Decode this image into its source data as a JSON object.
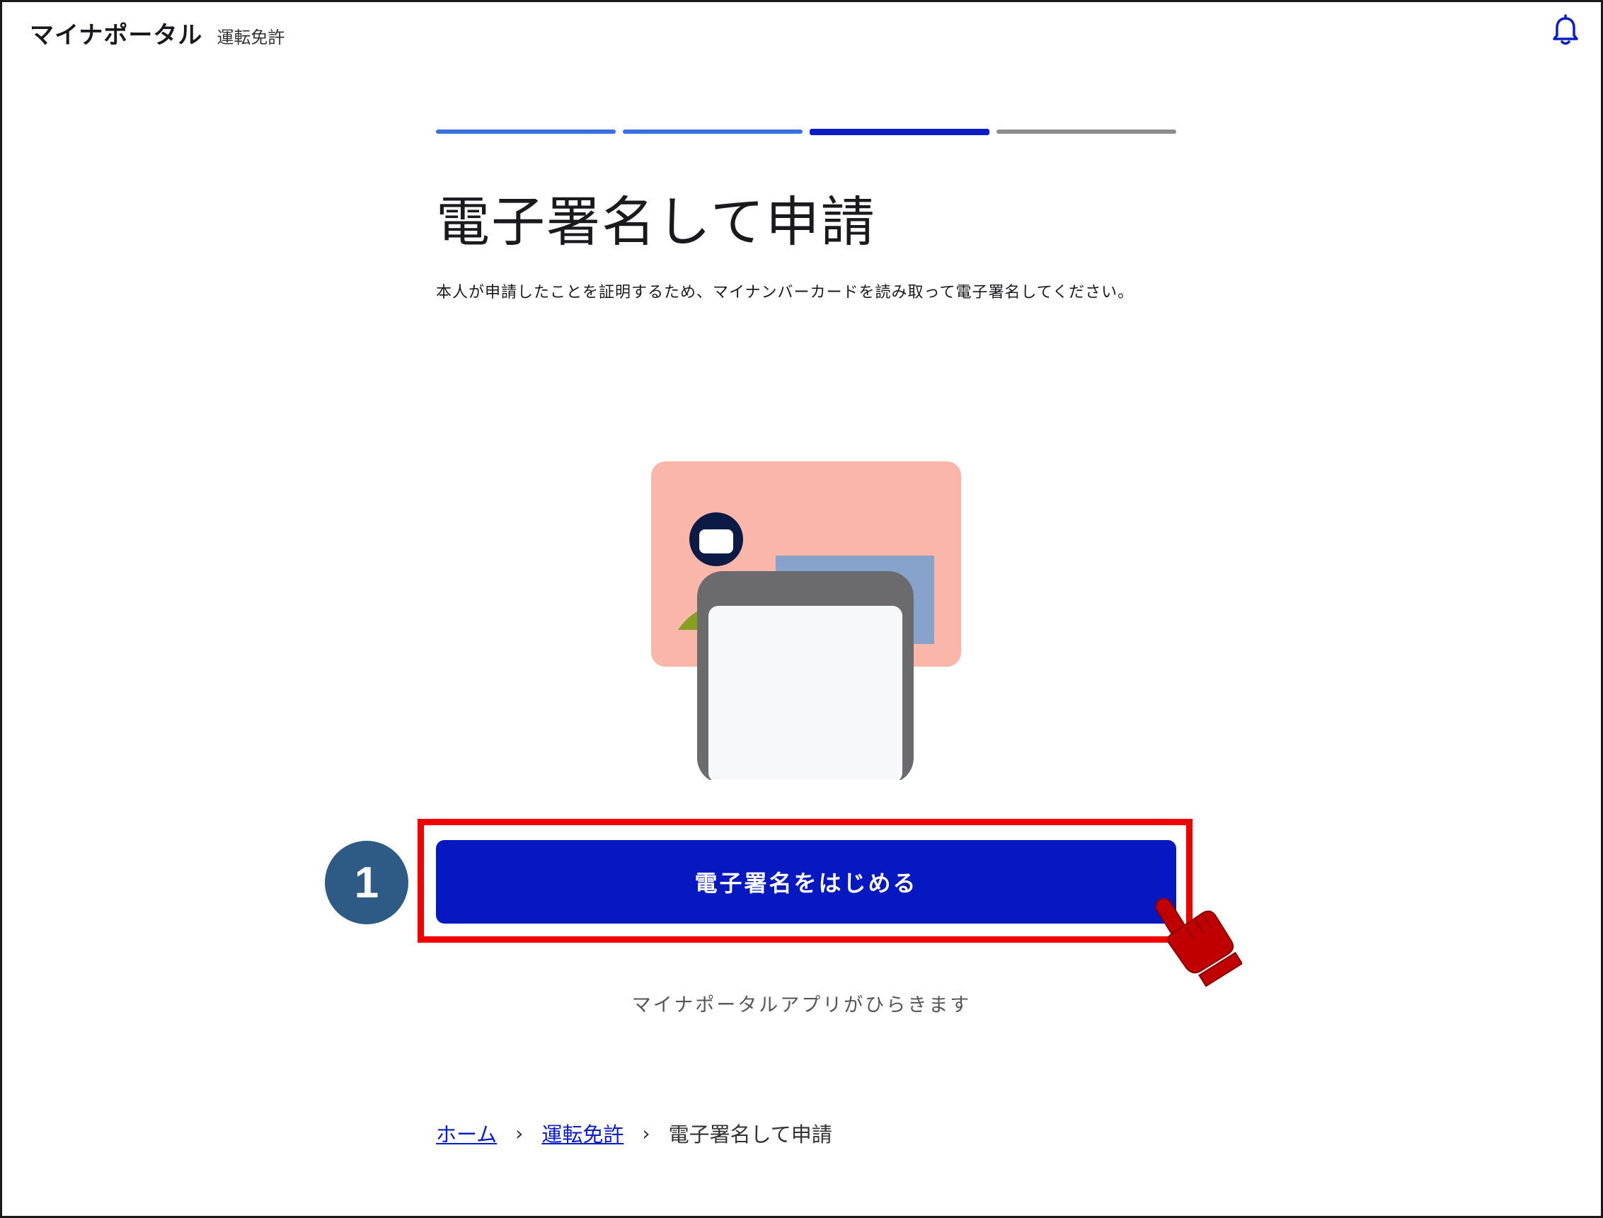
{
  "header": {
    "app_title": "マイナポータル",
    "subtitle": "運転免許",
    "bell_icon": "bell-icon"
  },
  "stepper": {
    "total_steps": 4,
    "current_step": 3,
    "colors": {
      "done": "#3b6fe0",
      "current": "#0a1ec4",
      "todo": "#8c8c8c"
    }
  },
  "main": {
    "title": "電子署名して申請",
    "description": "本人が申請したことを証明するため、マイナンバーカードを読み取って電子署名してください。",
    "illustration": "card-and-phone-illustration",
    "primary_button_label": "電子署名をはじめる",
    "button_note": "マイナポータルアプリがひらきます"
  },
  "annotation": {
    "step_number": "1",
    "highlight_color": "#f00000",
    "pointer": "hand-pointer-icon"
  },
  "breadcrumb": {
    "items": [
      {
        "label": "ホーム",
        "link": true
      },
      {
        "label": "運転免許",
        "link": true
      },
      {
        "label": "電子署名して申請",
        "link": false
      }
    ]
  },
  "colors": {
    "primary": "#0618c0",
    "text": "#1a1a1c"
  }
}
